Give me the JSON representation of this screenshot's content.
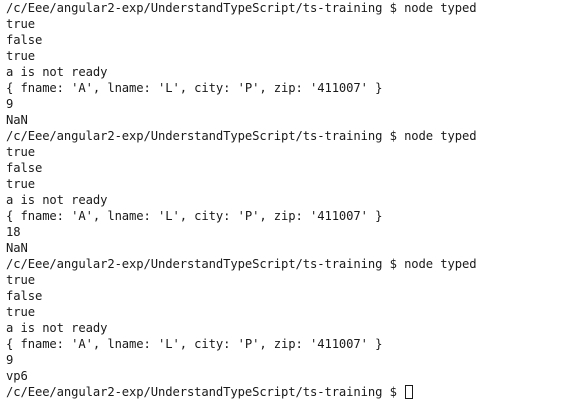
{
  "terminal": {
    "lines": [
      "/c/Eee/angular2-exp/UnderstandTypeScript/ts-training $ node typed",
      "true",
      "false",
      "true",
      "a is not ready",
      "{ fname: 'A', lname: 'L', city: 'P', zip: '411007' }",
      "9",
      "NaN",
      "/c/Eee/angular2-exp/UnderstandTypeScript/ts-training $ node typed",
      "true",
      "false",
      "true",
      "a is not ready",
      "{ fname: 'A', lname: 'L', city: 'P', zip: '411007' }",
      "18",
      "NaN",
      "/c/Eee/angular2-exp/UnderstandTypeScript/ts-training $ node typed",
      "true",
      "false",
      "true",
      "a is not ready",
      "{ fname: 'A', lname: 'L', city: 'P', zip: '411007' }",
      "9",
      "vp6"
    ],
    "prompt": "/c/Eee/angular2-exp/UnderstandTypeScript/ts-training $ "
  }
}
